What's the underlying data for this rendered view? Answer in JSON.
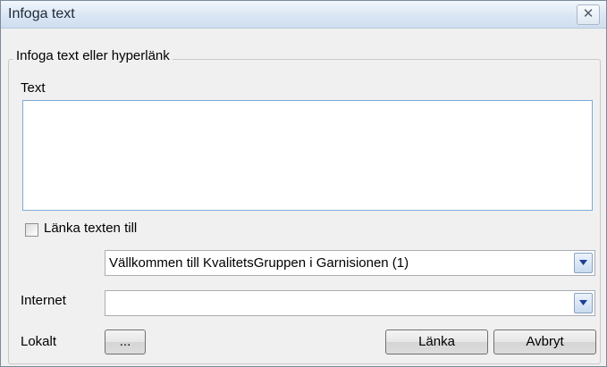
{
  "window": {
    "title": "Infoga text",
    "close_icon": "close-icon",
    "close_glyph": "✕"
  },
  "group": {
    "legend": "Infoga text eller hyperlänk"
  },
  "text_field": {
    "label": "Text",
    "value": ""
  },
  "link_checkbox": {
    "label": "Länka texten till",
    "checked": false
  },
  "page_select": {
    "value": "Vällkommen till KvalitetsGruppen  i Garnisionen (1)",
    "arrow_icon": "chevron-down-icon"
  },
  "internet": {
    "label": "Internet",
    "value": "",
    "arrow_icon": "chevron-down-icon"
  },
  "local": {
    "label": "Lokalt",
    "browse_label": "..."
  },
  "buttons": {
    "link_label": "Länka",
    "cancel_label": "Avbryt"
  },
  "colors": {
    "titlebar_top": "#f2f7fd",
    "titlebar_bottom": "#cfdeef",
    "dropdown_arrow": "#1c3f94",
    "dialog_bg": "#f0f0f0"
  }
}
